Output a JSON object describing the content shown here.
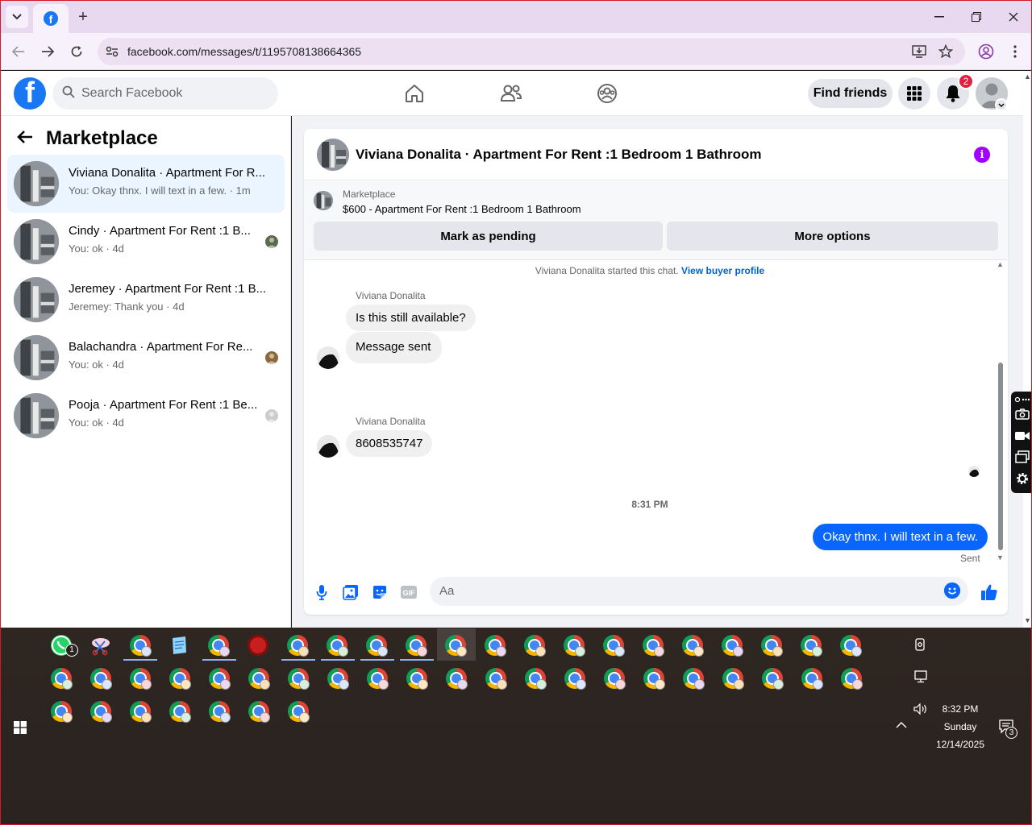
{
  "browser": {
    "url": "facebook.com/messages/t/1195708138664365",
    "new_tab_symbol": "+"
  },
  "facebook": {
    "search_placeholder": "Search Facebook",
    "find_friends": "Find friends",
    "notification_count": "2"
  },
  "marketplace": {
    "title": "Marketplace",
    "conversations": [
      {
        "name": "Viviana Donalita · Apartment For R...",
        "snippet": "You: Okay thnx. I will text in a few. · 1m",
        "active": true
      },
      {
        "name": "Cindy · Apartment For Rent :1 B...",
        "snippet": "You: ok · 4d"
      },
      {
        "name": "Jeremey · Apartment For Rent :1 B...",
        "snippet": "Jeremey: Thank you · 4d"
      },
      {
        "name": "Balachandra · Apartment For Re...",
        "snippet": "You: ok · 4d"
      },
      {
        "name": "Pooja · Apartment For Rent :1 Be...",
        "snippet": "You: ok · 4d"
      }
    ]
  },
  "chat": {
    "header_title": "Viviana Donalita · Apartment For Rent :1 Bedroom 1 Bathroom",
    "listing_category": "Marketplace",
    "listing_title": "$600 - Apartment For Rent :1 Bedroom 1 Bathroom",
    "mark_pending": "Mark as pending",
    "more_options": "More options",
    "system_message": "Viviana Donalita started this chat.",
    "view_buyer_profile": "View buyer profile",
    "messages": [
      {
        "sender": "Viviana Donalita",
        "text": "Is this still available?"
      },
      {
        "text": "Message sent"
      },
      {
        "sender": "Viviana Donalita",
        "text": "8608535747"
      }
    ],
    "timestamp": "8:31 PM",
    "outgoing": "Okay thnx. I will text in a few.",
    "status": "Sent",
    "composer_placeholder": "Aa"
  },
  "taskbar": {
    "whatsapp_badge": "1",
    "time": "8:32 PM",
    "day": "Sunday",
    "date": "12/14/2025",
    "notifications": "3"
  },
  "colors": {
    "fb_blue": "#1877f2",
    "messenger_blue": "#0866ff",
    "active_conv_bg": "#ebf5ff",
    "notification_red": "#e41e3f",
    "info_purple": "#a100ff"
  }
}
